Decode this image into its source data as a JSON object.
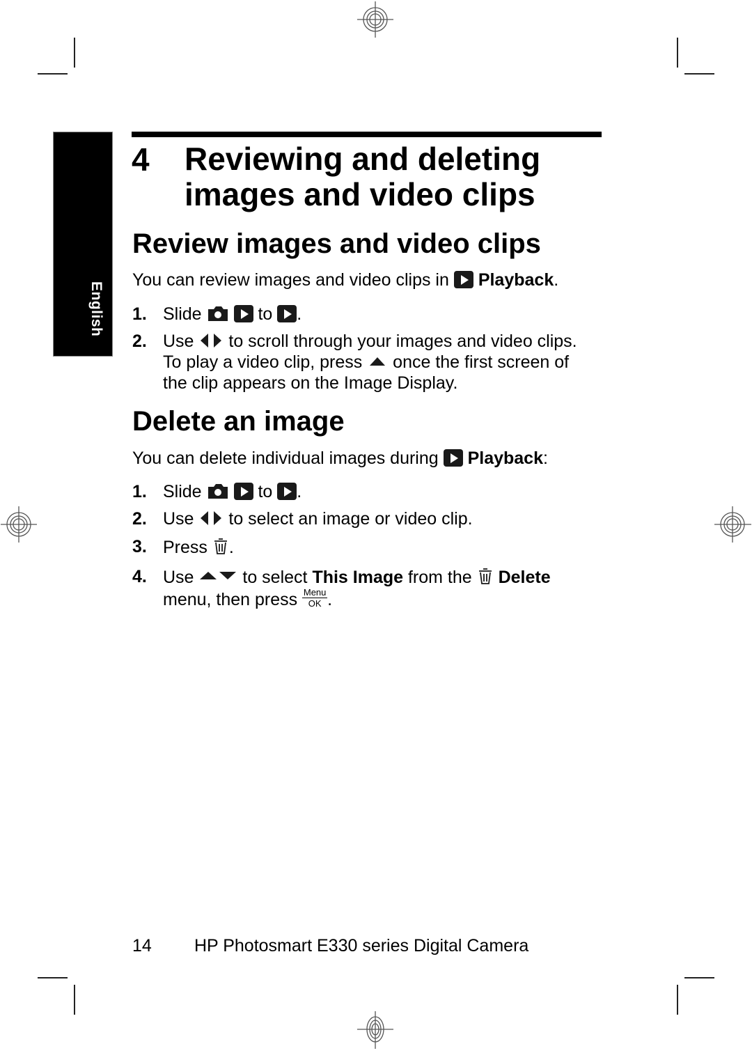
{
  "side_tab": {
    "label": "English"
  },
  "chapter": {
    "number": "4",
    "title": "Reviewing and deleting images and video clips"
  },
  "section_review": {
    "heading": "Review images and video clips",
    "intro_before": "You can review images and video clips in",
    "intro_mode": "Playback",
    "intro_after": ".",
    "steps": [
      {
        "num": "1.",
        "text_a": "Slide",
        "text_b": "to",
        "text_c": "."
      },
      {
        "num": "2.",
        "line1_a": "Use",
        "line1_b": "to scroll through your images and video clips.",
        "line2_a": "To play a video clip, press",
        "line2_b": "once the first screen of",
        "line3": "the clip appears on the Image Display."
      }
    ]
  },
  "section_delete": {
    "heading": "Delete an image",
    "intro_before": "You can delete individual images during",
    "intro_mode": "Playback",
    "intro_after": ":",
    "steps": [
      {
        "num": "1.",
        "text_a": "Slide",
        "text_b": "to",
        "text_c": "."
      },
      {
        "num": "2.",
        "text_a": "Use",
        "text_b": "to select an image or video clip."
      },
      {
        "num": "3.",
        "text_a": "Press",
        "text_b": "."
      },
      {
        "num": "4.",
        "line1_a": "Use",
        "line1_b": "to select",
        "line1_bold": "This Image",
        "line1_c": "from the",
        "line1_menu": "Delete",
        "line2_a": "menu, then press",
        "line2_b": ".",
        "menu_ok_top": "Menu",
        "menu_ok_bottom": "OK"
      }
    ]
  },
  "icons": {
    "playback": "playback-icon",
    "camera": "camera-icon",
    "left_right": "left-right-arrows-icon",
    "up": "up-arrow-icon",
    "up_down": "up-down-arrows-icon",
    "trash": "trash-icon",
    "menu_ok": "menu-ok-button-icon"
  },
  "footer": {
    "page_number": "14",
    "product": "HP Photosmart E330 series Digital Camera"
  }
}
